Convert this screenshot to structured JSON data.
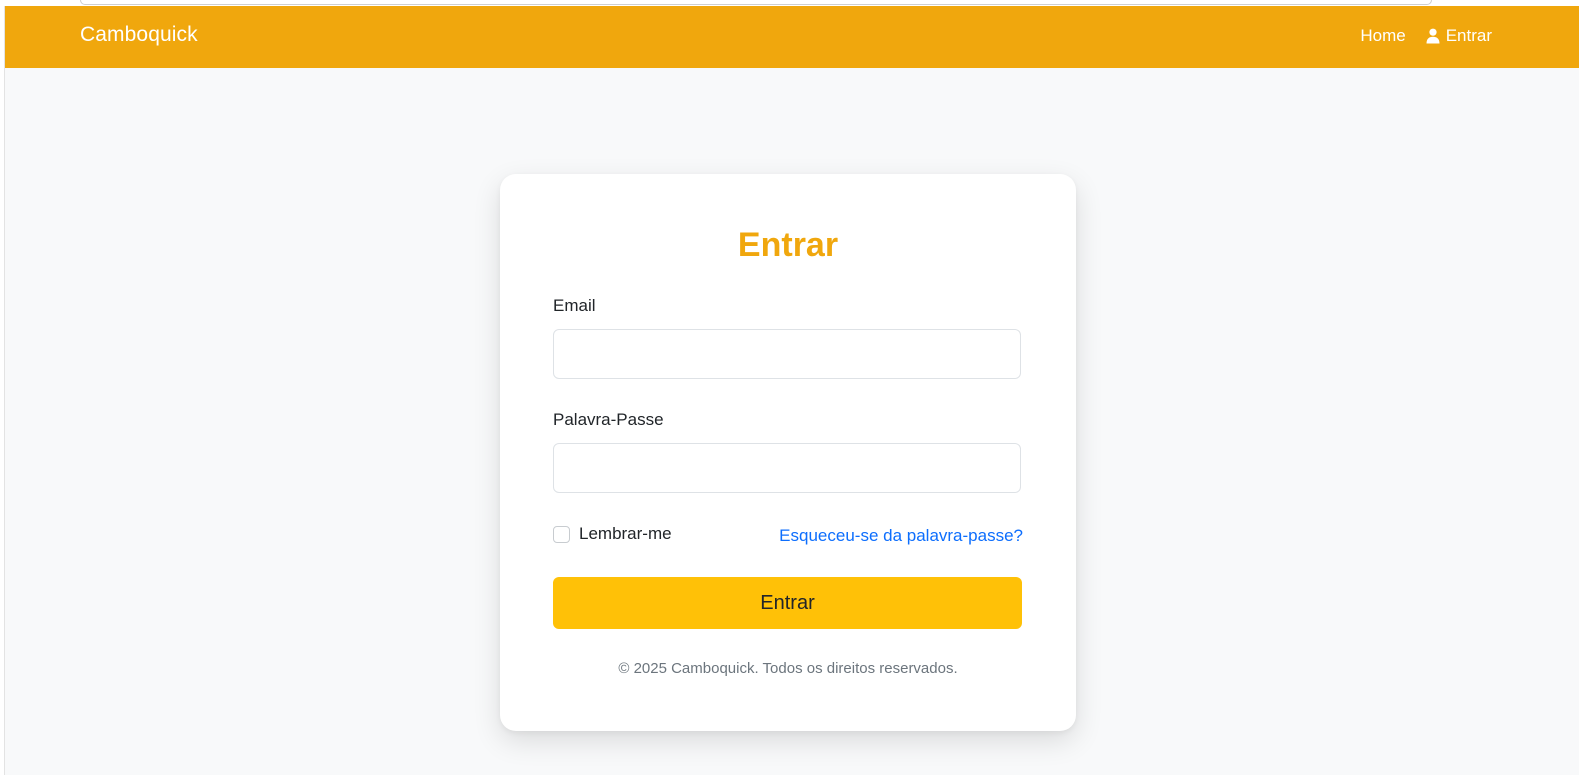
{
  "navbar": {
    "brand": "Camboquick",
    "links": [
      {
        "label": "Home",
        "icon": null
      },
      {
        "label": "Entrar",
        "icon": "user-icon"
      }
    ],
    "background": "#f0a70d"
  },
  "login": {
    "title": "Entrar",
    "email_label": "Email",
    "email_value": "",
    "password_label": "Palavra-Passe",
    "password_value": "",
    "remember_label": "Lembrar-me",
    "remember_checked": false,
    "forgot_link": "Esqueceu-se da palavra-passe?",
    "submit_label": "Entrar",
    "footer": "© 2025 Camboquick. Todos os direitos reservados."
  },
  "colors": {
    "accent": "#f0a70d",
    "button": "#ffc107",
    "link": "#0d6efd"
  }
}
